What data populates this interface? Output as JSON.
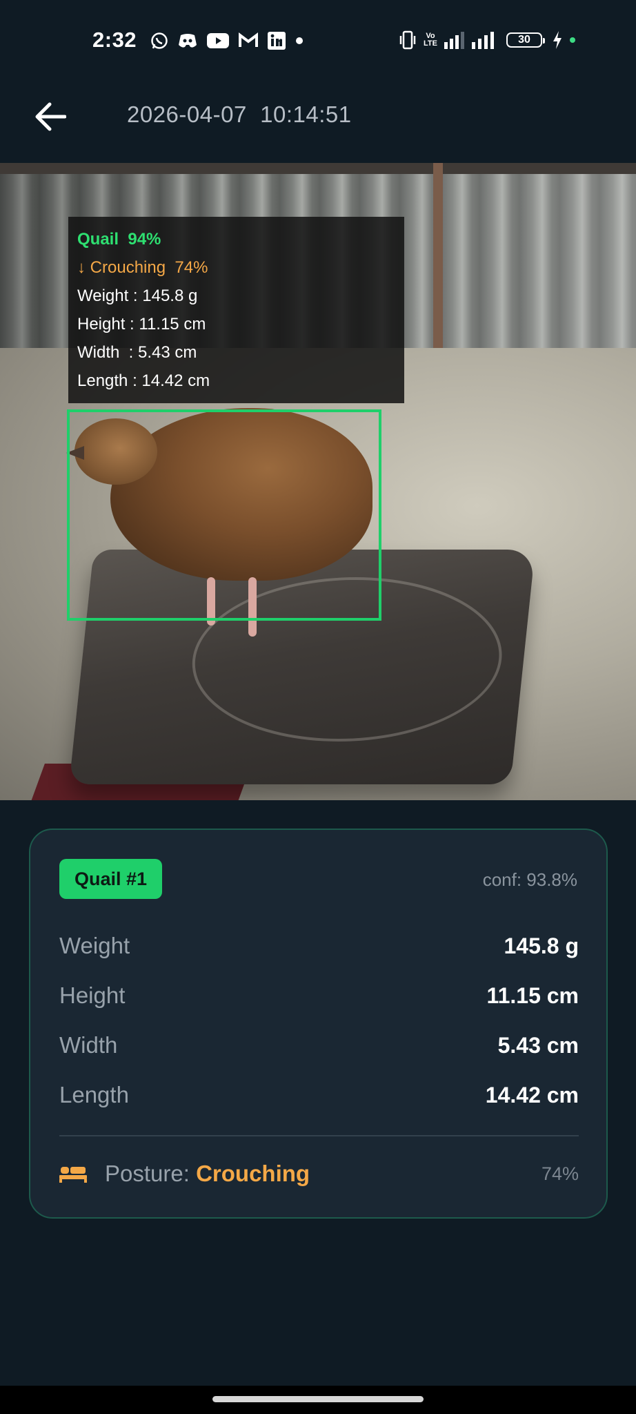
{
  "status_bar": {
    "time": "2:32",
    "left_icons": [
      "whatsapp-icon",
      "discord-icon",
      "youtube-icon",
      "gmail-icon",
      "linkedin-icon",
      "dot-icon"
    ],
    "right_icons": [
      "vibrate-icon",
      "volte-icon",
      "signal-icon",
      "signal-icon",
      "battery-icon",
      "charging-icon"
    ],
    "volte_label": "Vo\nLTE",
    "battery_level": "30",
    "indicator_color": "#3ddc84"
  },
  "header": {
    "back_icon": "arrow-left-icon",
    "timestamp": "2026-04-07  10:14:51"
  },
  "photo_overlay": {
    "species_line": "Quail  94%",
    "posture_line": "↓ Crouching  74%",
    "weight_line": "Weight : 145.8 g",
    "height_line": "Height : 11.15 cm",
    "width_line": "Width  : 5.43 cm",
    "length_line": "Length : 14.42 cm",
    "box_color": "#1fcf6a"
  },
  "result_card": {
    "badge": "Quail #1",
    "confidence": "conf: 93.8%",
    "rows": [
      {
        "label": "Weight",
        "value": "145.8 g"
      },
      {
        "label": "Height",
        "value": "11.15 cm"
      },
      {
        "label": "Width",
        "value": "5.43 cm"
      },
      {
        "label": "Length",
        "value": "14.42 cm"
      }
    ],
    "posture": {
      "icon": "bed-icon",
      "label": "Posture: ",
      "value": "Crouching",
      "percent": "74%"
    }
  },
  "colors": {
    "background": "#0f1b24",
    "card": "#1a2733",
    "accent_green": "#1fcf6a",
    "accent_orange": "#f4a847"
  }
}
